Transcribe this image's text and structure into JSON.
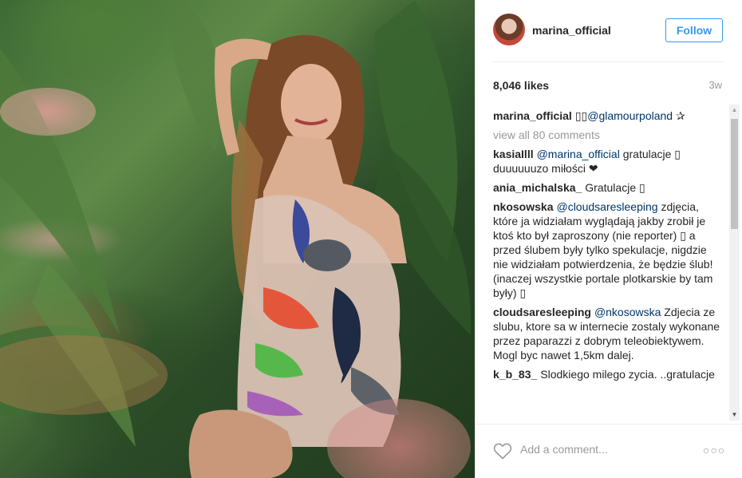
{
  "post": {
    "username": "marina_official",
    "follow_label": "Follow",
    "likes": "8,046 likes",
    "age": "3w"
  },
  "caption": {
    "user": "marina_official",
    "emoji": "▯▯",
    "mention": "@glamourpoland",
    "suffix": "✰"
  },
  "view_all": "view all 80 comments",
  "comments": [
    {
      "user": "kasiaIlll",
      "mention": "@marina_official",
      "text": " gratulacje ▯ duuuuuuzo miłości ❤"
    },
    {
      "user": "ania_michalska_",
      "mention": "",
      "text": "Gratulacje ▯"
    },
    {
      "user": "nkosowska",
      "mention": "@cloudsaresleeping",
      "text": " zdjęcia, które ja widziałam wyglądają jakby zrobił je ktoś kto był zaproszony (nie reporter) ▯ a przed ślubem były tylko spekulacje, nigdzie nie widziałam potwierdzenia, że będzie ślub! (inaczej wszystkie portale plotkarskie by tam były) ▯"
    },
    {
      "user": "cloudsaresleeping",
      "mention": "@nkosowska",
      "text": " Zdjecia ze slubu, ktore sa w internecie zostaly wykonane przez paparazzi z dobrym teleobiektywem. Mogl byc nawet 1,5km dalej."
    },
    {
      "user": "k_b_83_",
      "mention": "",
      "text": "Slodkiego milego zycia. ..gratulacje"
    }
  ],
  "add_comment_placeholder": "Add a comment...",
  "more_label": "○○○",
  "scroll": {
    "up": "▲",
    "down": "▼"
  },
  "icons": {
    "like": "heart-icon",
    "options": "more-options-icon"
  },
  "colors": {
    "accent": "#3897f0",
    "mention": "#003569",
    "muted": "#999999"
  }
}
